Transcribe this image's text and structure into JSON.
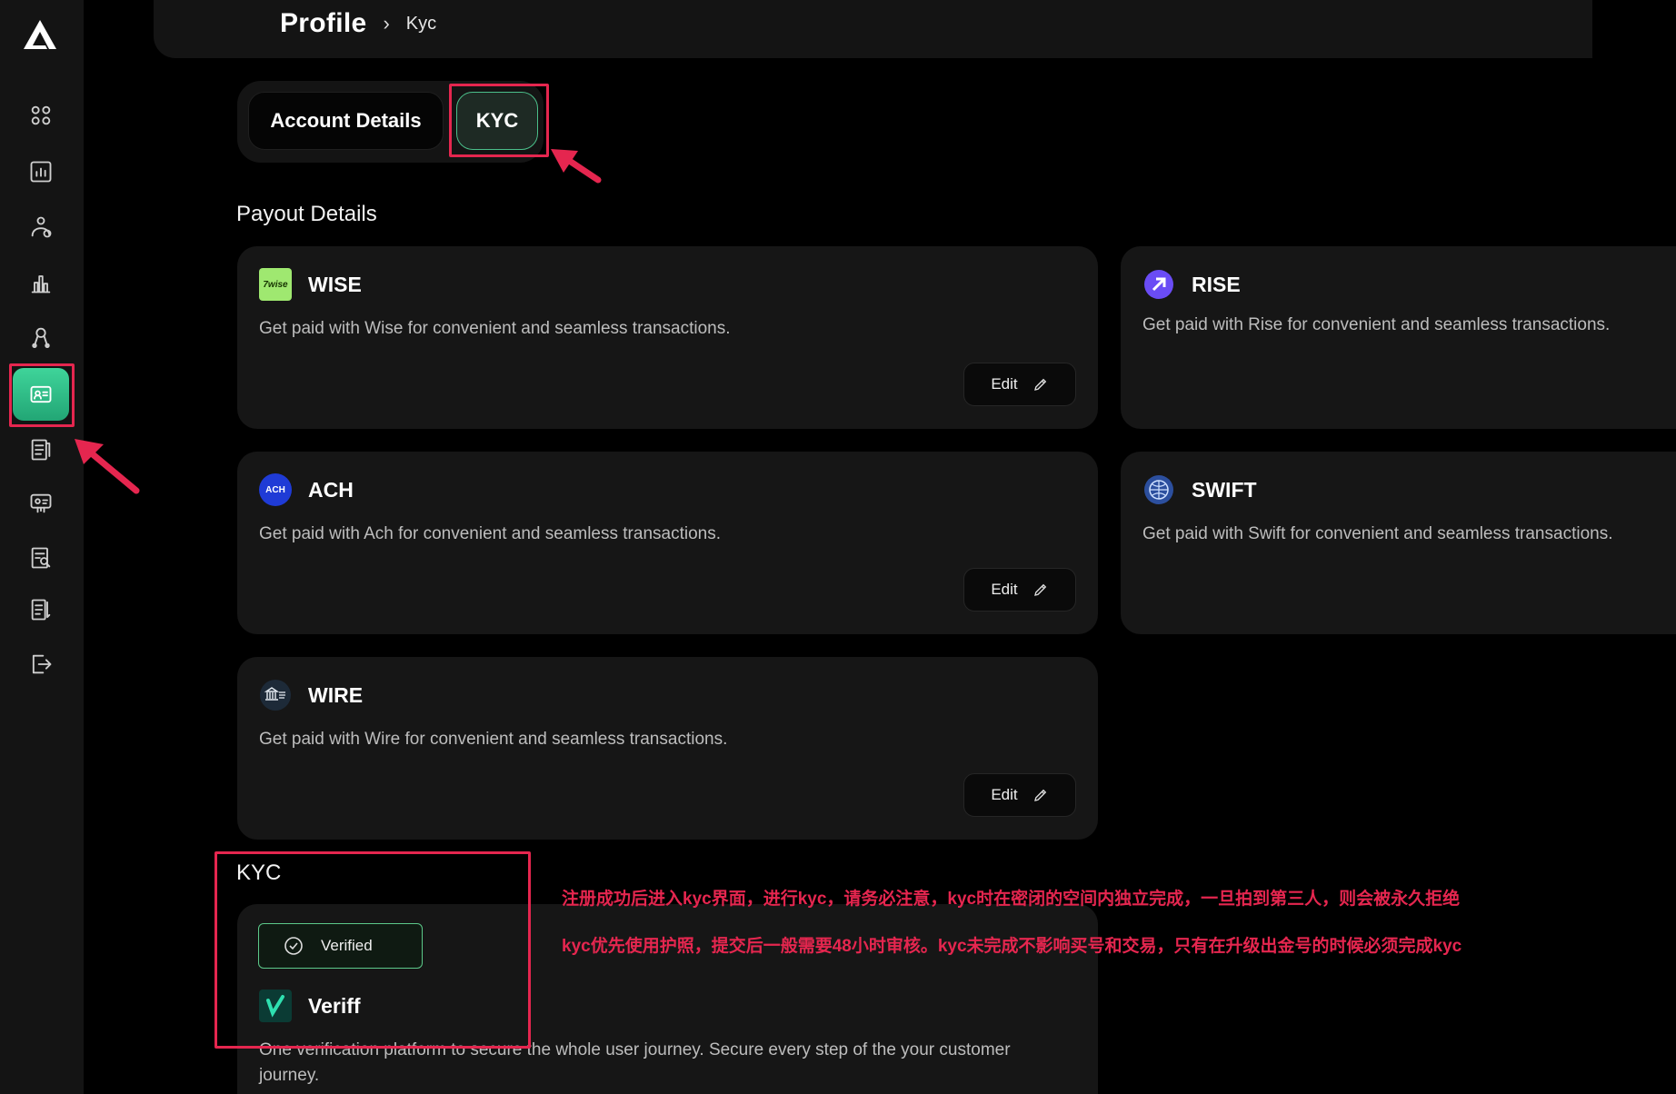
{
  "breadcrumb": {
    "title": "Profile",
    "separator": "›",
    "current": "Kyc"
  },
  "tabs": [
    {
      "label": "Account Details"
    },
    {
      "label": "KYC"
    }
  ],
  "payout": {
    "title": "Payout Details",
    "edit_label": "Edit",
    "methods": [
      {
        "name": "WISE",
        "logo_text": "7wise",
        "desc": "Get paid with Wise for convenient and seamless transactions."
      },
      {
        "name": "RISE",
        "logo_text": "",
        "desc": "Get paid with Rise for convenient and seamless transactions."
      },
      {
        "name": "ACH",
        "logo_text": "ACH",
        "desc": "Get paid with Ach for convenient and seamless transactions."
      },
      {
        "name": "SWIFT",
        "logo_text": "",
        "desc": "Get paid with Swift for convenient and seamless transactions."
      },
      {
        "name": "WIRE",
        "logo_text": "",
        "desc": "Get paid with Wire for convenient and seamless transactions."
      }
    ]
  },
  "kyc": {
    "title": "KYC",
    "status": "Verified",
    "provider": "Veriff",
    "desc_line1": "One verification platform to secure the whole user journey. Secure every step of the your customer",
    "desc_line2": "journey."
  },
  "notes": [
    "注册成功后进入kyc界面，进行kyc，请务必注意，kyc时在密闭的空间内独立完成，一旦拍到第三人，则会被永久拒绝",
    "kyc优先使用护照，提交后一般需要48小时审核。kyc未完成不影响买号和交易，只有在升级出金号的时候必须完成kyc"
  ],
  "colors": {
    "accent_green": "#3fd49a",
    "annotation_red": "#e5264f",
    "card_bg": "#161616"
  }
}
